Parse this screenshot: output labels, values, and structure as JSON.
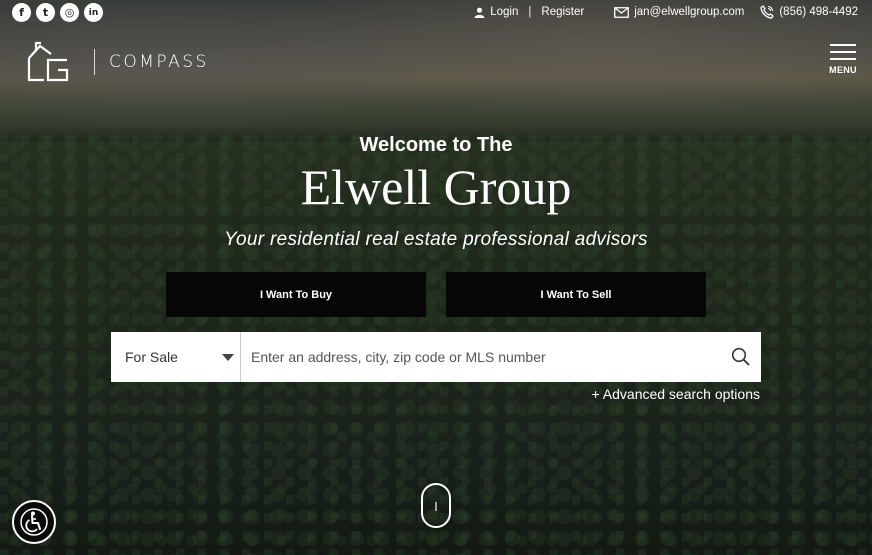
{
  "social": [
    {
      "icon": "facebook-icon",
      "glyph": "f"
    },
    {
      "icon": "twitter-icon",
      "glyph": "t"
    },
    {
      "icon": "instagram-icon",
      "glyph": "◎"
    },
    {
      "icon": "linkedin-icon",
      "glyph": "in"
    }
  ],
  "topbar": {
    "login_label": "Login",
    "register_label": "Register",
    "email": "jan@elwellgroup.com",
    "phone": "(856) 498-4492"
  },
  "logo": {
    "wordmark": "COMPASS"
  },
  "menu": {
    "label": "MENU"
  },
  "hero": {
    "welcome": "Welcome to The",
    "brand": "Elwell Group",
    "tagline": "Your residential real estate professional advisors"
  },
  "cta": {
    "buy_label": "I Want To Buy",
    "sell_label": "I Want To Sell"
  },
  "search": {
    "type_value": "For Sale",
    "placeholder": "Enter an address, city, zip code or MLS number",
    "advanced_label": "+ Advanced search options"
  },
  "colors": {
    "button_bg": "#060606",
    "search_bg": "#ffffff"
  }
}
